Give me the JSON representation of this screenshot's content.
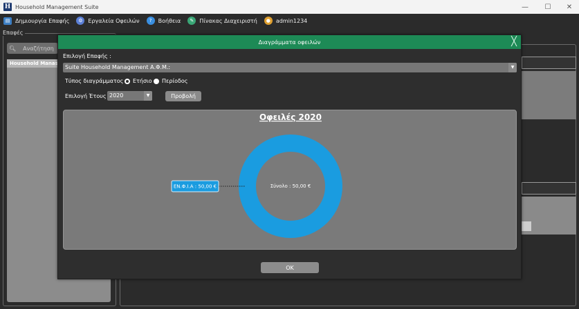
{
  "window": {
    "title": "Household Management Suite",
    "logo_letter": "H",
    "minimize": "—",
    "maximize": "☐",
    "close": "✕"
  },
  "menu": {
    "items": [
      {
        "label": "Δημιουργία Επαφής",
        "icon": "contact-card-icon"
      },
      {
        "label": "Εργαλεία Οφειλών",
        "icon": "debt-tools-icon"
      },
      {
        "label": "Βοήθεια",
        "icon": "help-icon"
      },
      {
        "label": "Πίνακας Διαχειριστή",
        "icon": "admin-panel-icon"
      },
      {
        "label": "admin1234",
        "icon": "user-icon"
      }
    ]
  },
  "main": {
    "contacts_label": "Επαφές",
    "search_placeholder": "Αναζήτηση",
    "list_header": "Household Manas"
  },
  "dialog": {
    "title": "Διαγράμματα οφειλών",
    "close_glyph": "╳",
    "contact_select_label": "Επιλογή Επαφής :",
    "contact_selected": "Suite Household Management Α.Φ.Μ.:",
    "chart_type_label": "Τύπος διαγράμματος :",
    "radio_annual": "Ετήσιο",
    "radio_period": "Περίοδος",
    "year_label": "Επιλογή Έτους :",
    "year_selected": "2020",
    "view_button": "Προβολή",
    "ok_button": "OK"
  },
  "chart_data": {
    "type": "pie",
    "title": "Οφειλές 2020",
    "slices": [
      {
        "label": "ΕΝ.Φ.Ι.Α",
        "value": 50.0,
        "value_label": "ΕΝ.Φ.Ι.Α : 50,00 €",
        "color": "#1a9ce0"
      }
    ],
    "center_label": "Σύνολο : 50,00 €",
    "donut": true
  },
  "colors": {
    "dialog_header": "#1d8a56",
    "donut": "#1a9ce0",
    "chart_bg": "#7a7a7a"
  }
}
